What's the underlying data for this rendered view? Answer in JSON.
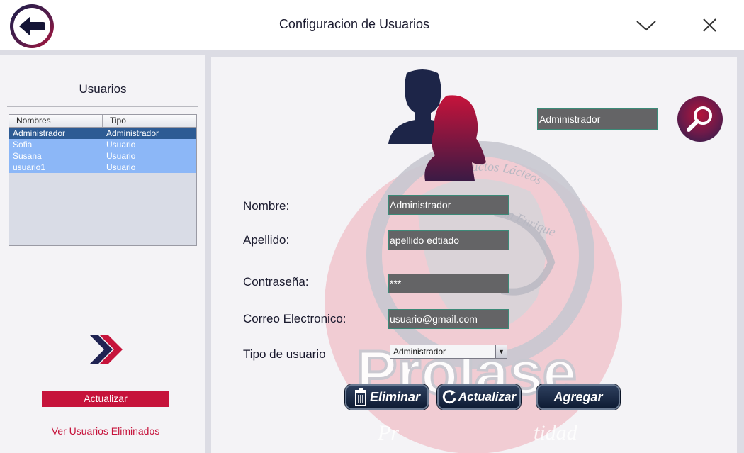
{
  "header": {
    "title": "Configuracion de Usuarios",
    "back_icon": "arrow-left-icon",
    "minimize_icon": "chevron-down-icon",
    "close_icon": "close-icon"
  },
  "sidebar": {
    "heading": "Usuarios",
    "table": {
      "columns": [
        "Nombres",
        "Tipo"
      ],
      "rows": [
        {
          "nombre": "Administrador",
          "tipo": "Administrador",
          "selected": true
        },
        {
          "nombre": "Sofia",
          "tipo": "Usuario",
          "selected": false
        },
        {
          "nombre": "Susana",
          "tipo": "Usuario",
          "selected": false
        },
        {
          "nombre": "usuario1",
          "tipo": "Usuario",
          "selected": false
        }
      ]
    },
    "forward_icon": "double-chevron-right-icon",
    "update_button": "Actualizar",
    "deleted_link": "Ver Usuarios Eliminados"
  },
  "main": {
    "search_value": "Administrador",
    "search_icon": "magnifier-icon",
    "watermark": {
      "brand": "Prolase",
      "arc_text": "Productos Lácteos",
      "sub_text": "San Enrique",
      "tagline_left": "Pr",
      "tagline_right": "tidad"
    },
    "form": {
      "nombre_label": "Nombre:",
      "nombre_value": "Administrador",
      "apellido_label": "Apellido:",
      "apellido_value": "apellido edtiado",
      "password_label": "Contraseña:",
      "password_value": "***",
      "email_label": "Correo Electronico:",
      "email_value": "usuario@gmail.com",
      "type_label": "Tipo de usuario",
      "type_value": "Administrador"
    },
    "buttons": {
      "delete": "Eliminar",
      "update": "Actualizar",
      "add": "Agregar"
    }
  },
  "colors": {
    "brand_red": "#c6133b",
    "navy": "#1a1d4a",
    "field_bg": "#646466",
    "row_selected": "#2d5b94",
    "row_normal": "#8cb7f7"
  }
}
